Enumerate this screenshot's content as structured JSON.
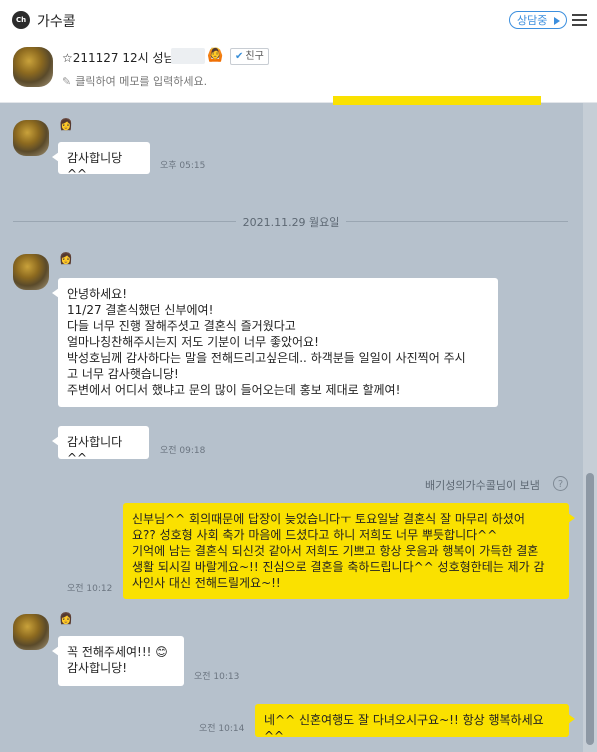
{
  "app": {
    "logo_text": "Ch",
    "title": "가수콜",
    "status_label": "상담중"
  },
  "profile": {
    "name": "☆211127 12시 성남",
    "emoji": "🙆",
    "friend_badge": "친구",
    "memo_placeholder": "클릭하여 메모를 입력하세요."
  },
  "icons": {
    "menu": "hamburger-icon",
    "pencil": "pencil-icon",
    "check": "check-icon",
    "gender": "woman-icon",
    "help": "question-icon"
  },
  "colors": {
    "accent": "#3c8fde",
    "my_bubble": "#fae100",
    "chat_bg": "#b6c1cc"
  },
  "messages": [
    {
      "id": "m1",
      "side": "left",
      "text": "감사합니당^^",
      "time": "오후 05:15"
    },
    {
      "id": "date",
      "type": "date",
      "text": "2021.11.29 월요일"
    },
    {
      "id": "m2",
      "side": "left",
      "text": "안녕하세요!\n11/27 결혼식했던 신부에여!\n다들 너무 진행 잘해주셧고 결혼식 즐거웠다고\n얼마나칭찬해주시는지 저도 기분이 너무 좋았어요!\n박성호님께 감사하다는 말을 전해드리고싶은데.. 하객분들 일일이 사진찍어 주시\n고 너무 감사햇습니당!\n주변에서 어디서 했냐고 문의 많이 들어오는데 홍보 제대로 할께여!"
    },
    {
      "id": "m3",
      "side": "left",
      "text": "감사합니다^^",
      "time": "오전 09:18"
    },
    {
      "id": "sender",
      "type": "sender",
      "text": "배기성의가수콜님이 보냄"
    },
    {
      "id": "m4",
      "side": "right",
      "text": "신부님^^ 회의때문에 답장이 늦었습니다ㅜ 토요일날 결혼식 잘 마무리 하셨어\n요?? 성호형 사회 축가 마음에 드셨다고 하니 저희도 너무 뿌듯합니다^^\n기억에 남는 결혼식 되신것 같아서 저희도 기쁘고 항상 웃음과 행복이 가득한 결혼\n생활 되시길 바랄게요~!! 진심으로 결혼을 축하드립니다^^ 성호형한테는 제가 감\n사인사 대신 전해드릴게요~!!",
      "time": "오전 10:12"
    },
    {
      "id": "m5",
      "side": "left",
      "text": "꼭 전해주세여!!! 😊\n감사합니당!",
      "time": "오전 10:13"
    },
    {
      "id": "m6",
      "side": "right",
      "text": "네^^ 신혼여행도 잘 다녀오시구요~!! 항상 행복하세요^^",
      "time": "오전 10:14"
    }
  ]
}
